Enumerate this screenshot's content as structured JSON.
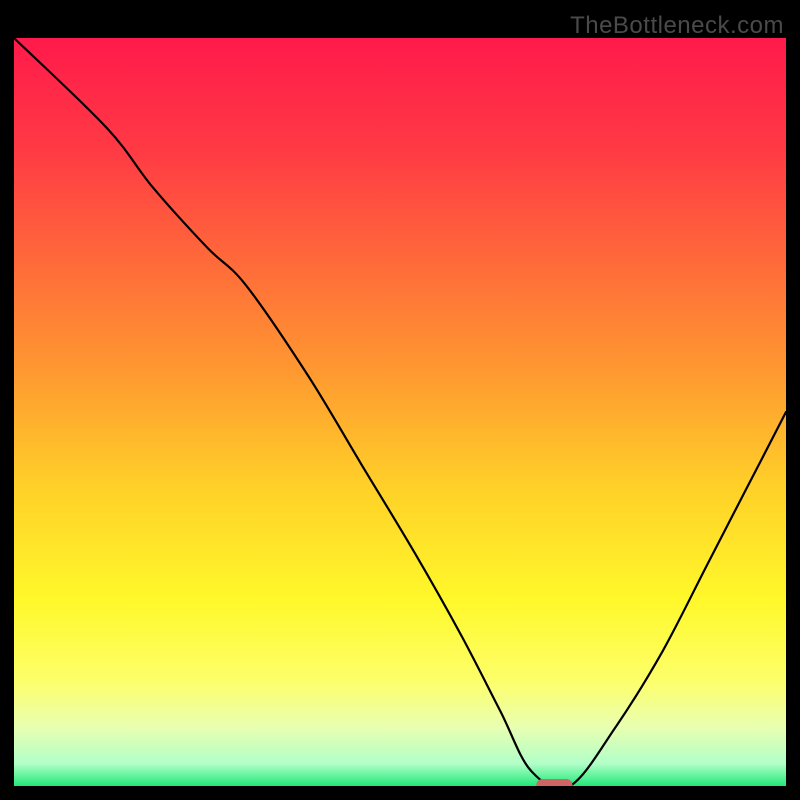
{
  "watermark": "TheBottleneck.com",
  "chart_data": {
    "type": "line",
    "title": "",
    "xlabel": "",
    "ylabel": "",
    "xlim": [
      0,
      100
    ],
    "ylim": [
      0,
      100
    ],
    "grid": false,
    "line_color": "#000000",
    "line_width": 2,
    "marker": {
      "x": 70,
      "y": 0,
      "color": "#d06565",
      "shape": "capsule"
    },
    "gradient_stops": [
      {
        "offset": 0.0,
        "color": "#ff1a4b"
      },
      {
        "offset": 0.15,
        "color": "#ff3a44"
      },
      {
        "offset": 0.3,
        "color": "#ff6a3a"
      },
      {
        "offset": 0.45,
        "color": "#ff9a30"
      },
      {
        "offset": 0.6,
        "color": "#ffd028"
      },
      {
        "offset": 0.75,
        "color": "#fff82a"
      },
      {
        "offset": 0.86,
        "color": "#fdff6a"
      },
      {
        "offset": 0.92,
        "color": "#e9ffb0"
      },
      {
        "offset": 0.97,
        "color": "#b2ffc8"
      },
      {
        "offset": 1.0,
        "color": "#20e879"
      }
    ],
    "x": [
      0,
      12,
      18,
      25,
      30,
      38,
      45,
      52,
      58,
      63,
      67,
      72,
      78,
      84,
      90,
      95,
      100
    ],
    "values": [
      100,
      88,
      80,
      72,
      67,
      55,
      43,
      31,
      20,
      10,
      2,
      0,
      8,
      18,
      30,
      40,
      50
    ]
  }
}
